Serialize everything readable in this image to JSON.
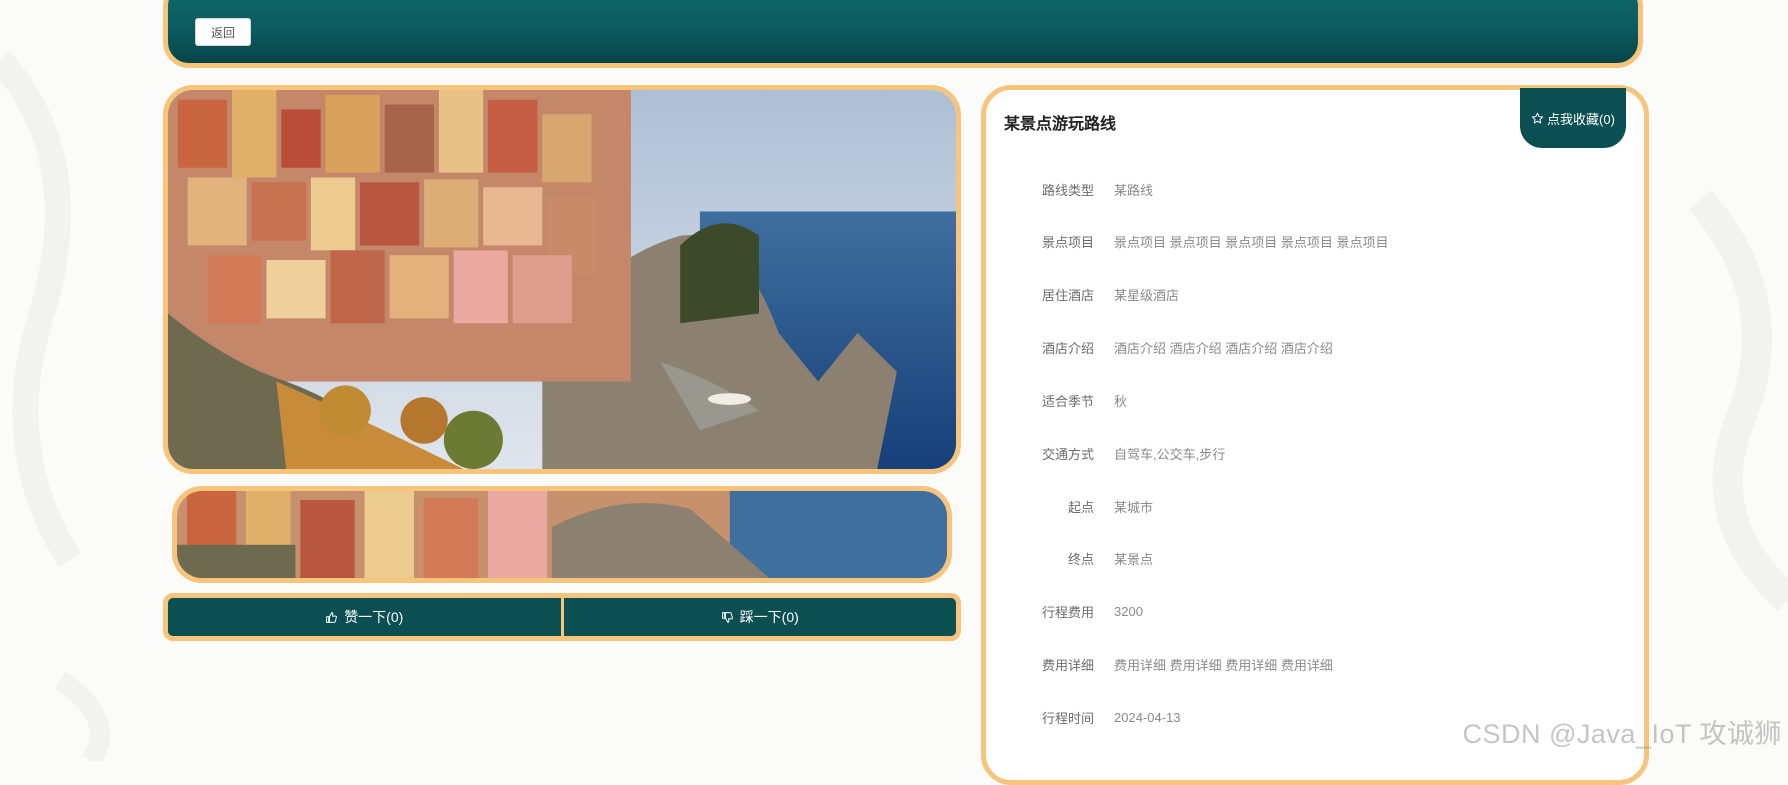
{
  "header": {
    "back_label": "返回"
  },
  "votes": {
    "like_label": "赞一下(0)",
    "dislike_label": "踩一下(0)"
  },
  "detail": {
    "title": "某景点游玩路线",
    "favorite_label": "点我收藏(0)",
    "fields": [
      {
        "label": "路线类型",
        "value": "某路线"
      },
      {
        "label": "景点项目",
        "value": "景点项目 景点项目 景点项目 景点项目 景点项目"
      },
      {
        "label": "居住酒店",
        "value": "某星级酒店"
      },
      {
        "label": "酒店介绍",
        "value": "酒店介绍 酒店介绍 酒店介绍 酒店介绍"
      },
      {
        "label": "适合季节",
        "value": "秋"
      },
      {
        "label": "交通方式",
        "value": "自驾车,公交车,步行"
      },
      {
        "label": "起点",
        "value": "某城市"
      },
      {
        "label": "终点",
        "value": "某景点"
      },
      {
        "label": "行程费用",
        "value": "3200"
      },
      {
        "label": "费用详细",
        "value": "费用详细 费用详细 费用详细 费用详细"
      },
      {
        "label": "行程时间",
        "value": "2024-04-13"
      }
    ]
  },
  "watermark": "CSDN @Java_IoT 攻诚狮",
  "colors": {
    "teal": "#0b4f52",
    "border": "#f7c47b"
  },
  "icons": {
    "favorite": "star-outline-icon",
    "like": "thumbs-up-icon",
    "dislike": "thumbs-down-icon"
  }
}
